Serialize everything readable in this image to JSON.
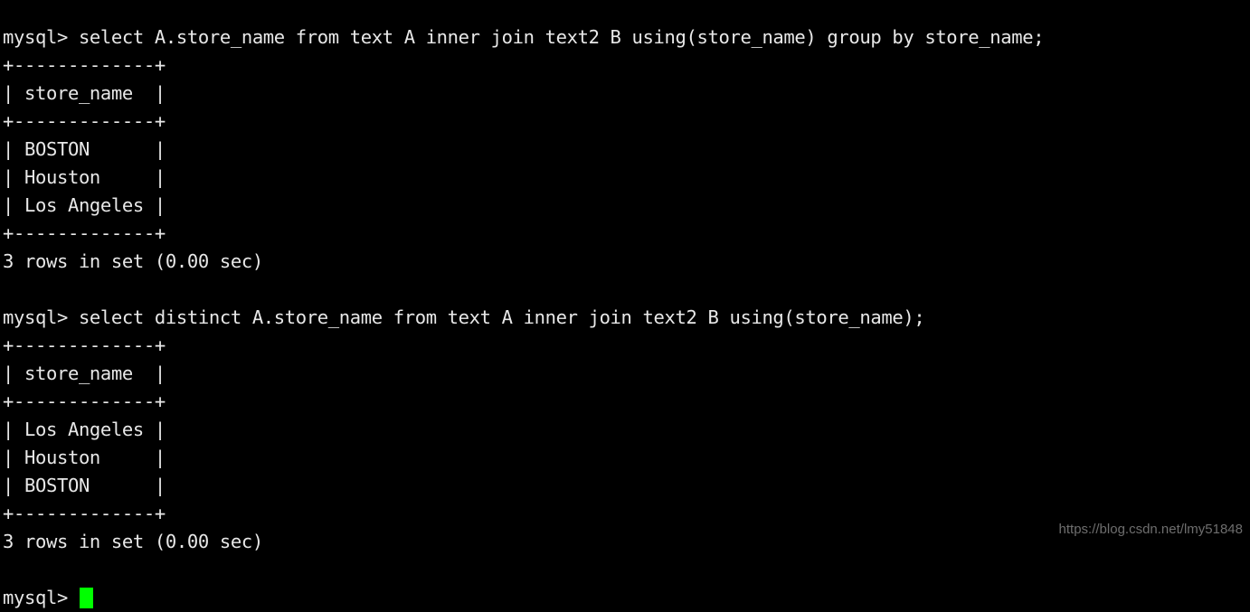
{
  "terminal": {
    "background_color": "#000000",
    "text_color": "#e8e8e8",
    "cursor_color": "#00ff00",
    "prompt": "mysql> ",
    "lines": [
      "mysql> select A.store_name from text A inner join text2 B using(store_name) group by store_name;",
      "+-------------+",
      "| store_name  |",
      "+-------------+",
      "| BOSTON      |",
      "| Houston     |",
      "| Los Angeles |",
      "+-------------+",
      "3 rows in set (0.00 sec)",
      "",
      "mysql> select distinct A.store_name from text A inner join text2 B using(store_name);",
      "+-------------+",
      "| store_name  |",
      "+-------------+",
      "| Los Angeles |",
      "| Houston     |",
      "| BOSTON      |",
      "+-------------+",
      "3 rows in set (0.00 sec)",
      ""
    ],
    "queries": [
      {
        "command": "select A.store_name from text A inner join text2 B using(store_name) group by store_name;",
        "result_columns": [
          "store_name"
        ],
        "result_rows": [
          "BOSTON",
          "Houston",
          "Los Angeles"
        ],
        "status": "3 rows in set (0.00 sec)"
      },
      {
        "command": "select distinct A.store_name from text A inner join text2 B using(store_name);",
        "result_columns": [
          "store_name"
        ],
        "result_rows": [
          "Los Angeles",
          "Houston",
          "BOSTON"
        ],
        "status": "3 rows in set (0.00 sec)"
      }
    ]
  },
  "watermark": {
    "text": "https://blog.csdn.net/lmy51848",
    "color": "#6e6e6e"
  }
}
